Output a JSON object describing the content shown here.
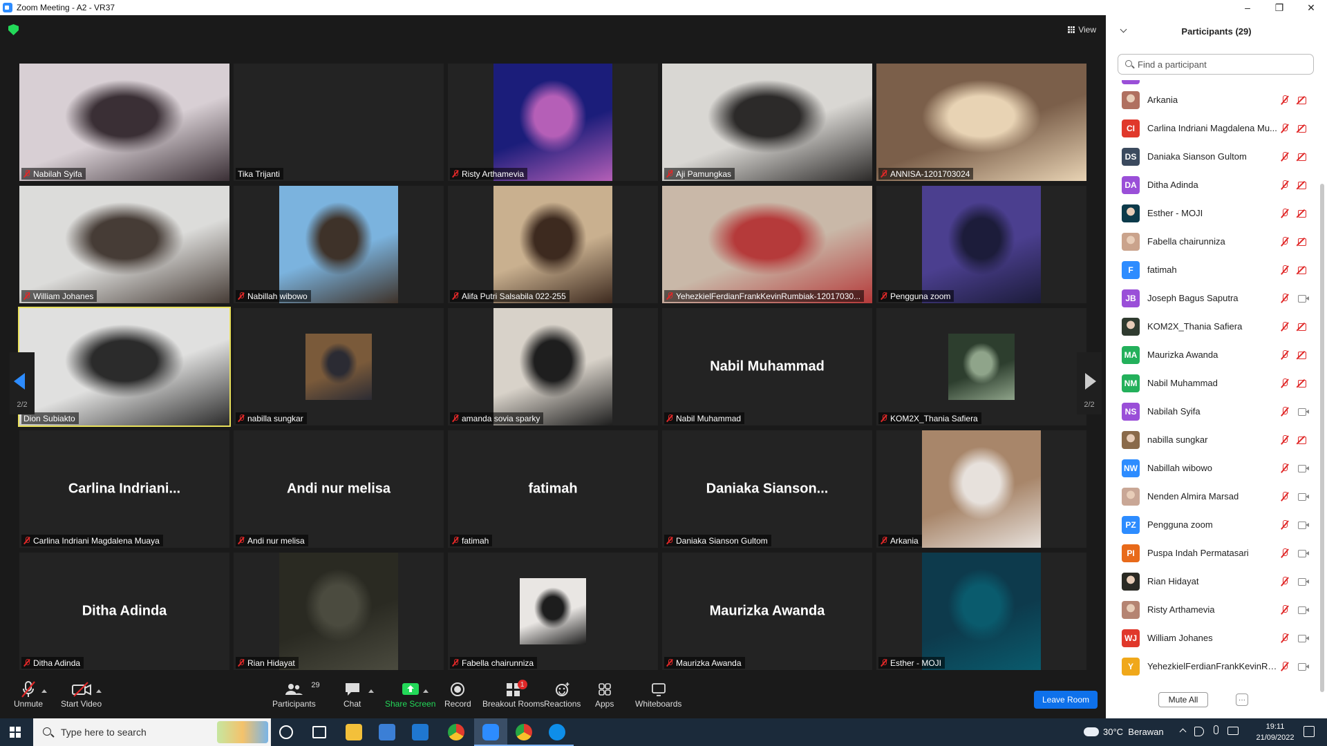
{
  "window": {
    "title": "Zoom Meeting - A2 - VR37",
    "min": "–",
    "max": "❐",
    "close": "✕"
  },
  "stage": {
    "view_label": "View",
    "page_left": "2/2",
    "page_right": "2/2"
  },
  "tiles": [
    {
      "name": "Nabilah Syifa",
      "muted": true,
      "kind": "video",
      "colors": [
        "#d8cfd4",
        "#3a2f35"
      ]
    },
    {
      "name": "Tika Trijanti",
      "muted": false,
      "kind": "dark"
    },
    {
      "name": "Risty Arthamevia",
      "muted": true,
      "kind": "video-narrow",
      "colors": [
        "#1b1d7a",
        "#b55fb7"
      ]
    },
    {
      "name": "Aji Pamungkas",
      "muted": true,
      "kind": "video",
      "colors": [
        "#d9d7d3",
        "#2c2a29"
      ]
    },
    {
      "name": "ANNISA-1201703024",
      "muted": true,
      "kind": "video",
      "colors": [
        "#7b5f4a",
        "#e8d3b4"
      ]
    },
    {
      "name": "William Johanes",
      "muted": true,
      "kind": "video",
      "colors": [
        "#dcdcda",
        "#463c36"
      ]
    },
    {
      "name": "Nabillah wibowo",
      "muted": true,
      "kind": "video-narrow",
      "colors": [
        "#7bb3de",
        "#3e3229"
      ]
    },
    {
      "name": "Alifa Putri Salsabila 022-255",
      "muted": true,
      "kind": "video-narrow",
      "colors": [
        "#c9b08f",
        "#3d2a1f"
      ]
    },
    {
      "name": "YehezkielFerdianFrankKevinRumbiak-12017030...",
      "muted": true,
      "kind": "video",
      "colors": [
        "#c9b8a8",
        "#b53a3a"
      ]
    },
    {
      "name": "Pengguna zoom",
      "muted": true,
      "kind": "video-narrow",
      "colors": [
        "#4b3f8f",
        "#1c1c3a"
      ]
    },
    {
      "name": "Dion Subiakto",
      "muted": false,
      "kind": "video",
      "active": true,
      "colors": [
        "#e0e0df",
        "#2b2b2b"
      ]
    },
    {
      "name": "nabilla sungkar",
      "muted": true,
      "kind": "video-small",
      "colors": [
        "#7a5a3a",
        "#2b2b33"
      ]
    },
    {
      "name": "amanda sovia sparky",
      "muted": true,
      "kind": "video-narrow",
      "colors": [
        "#d8d2c9",
        "#1e1e1e"
      ]
    },
    {
      "name": "Nabil Muhammad",
      "muted": true,
      "kind": "name",
      "big": "Nabil Muhammad"
    },
    {
      "name": "KOM2X_Thania Safiera",
      "muted": true,
      "kind": "video-small",
      "colors": [
        "#2d3e2e",
        "#8fa48a"
      ]
    },
    {
      "name": "Carlina Indriani Magdalena Muaya",
      "muted": true,
      "kind": "name",
      "big": "Carlina  Indriani..."
    },
    {
      "name": "Andi nur melisa",
      "muted": true,
      "kind": "name",
      "big": "Andi nur melisa"
    },
    {
      "name": "fatimah",
      "muted": true,
      "kind": "name",
      "big": "fatimah"
    },
    {
      "name": "Daniaka Sianson Gultom",
      "muted": true,
      "kind": "name",
      "big": "Daniaka  Sianson..."
    },
    {
      "name": "Arkania",
      "muted": true,
      "kind": "video-narrow",
      "colors": [
        "#a8866a",
        "#e7e1dc"
      ]
    },
    {
      "name": "Ditha Adinda",
      "muted": true,
      "kind": "name",
      "big": "Ditha Adinda"
    },
    {
      "name": "Rian Hidayat",
      "muted": true,
      "kind": "video-narrow",
      "colors": [
        "#2a2a22",
        "#4b4b3f"
      ]
    },
    {
      "name": "Fabella chairunniza",
      "muted": true,
      "kind": "video-small",
      "colors": [
        "#e9e6e3",
        "#1d1d1d"
      ]
    },
    {
      "name": "Maurizka Awanda",
      "muted": true,
      "kind": "name",
      "big": "Maurizka Awanda"
    },
    {
      "name": "Esther - MOJI",
      "muted": true,
      "kind": "video-narrow",
      "colors": [
        "#0d3a4c",
        "#0a5b6d"
      ]
    }
  ],
  "toolbar": {
    "unmute": "Unmute",
    "start_video": "Start Video",
    "participants": "Participants",
    "participants_count": "29",
    "chat": "Chat",
    "share_screen": "Share Screen",
    "record": "Record",
    "breakout_rooms": "Breakout Rooms",
    "breakout_badge": "1",
    "reactions": "Reactions",
    "apps": "Apps",
    "whiteboards": "Whiteboards",
    "leave": "Leave Room",
    "colors": {
      "share": "#23d959",
      "leave": "#0e71eb",
      "badge": "#e02828"
    }
  },
  "panel": {
    "title": "Participants (29)",
    "search_placeholder": "Find a participant",
    "mute_all": "Mute All",
    "more": "···",
    "participants": [
      {
        "name": "Arkania",
        "initials": "",
        "color": "#b07060",
        "photo": true,
        "cam_on": false
      },
      {
        "name": "Carlina Indriani Magdalena Mu...",
        "initials": "CI",
        "color": "#e0382b",
        "cam_on": false
      },
      {
        "name": "Daniaka Sianson Gultom",
        "initials": "DS",
        "color": "#3b4a5e",
        "cam_on": false
      },
      {
        "name": "Ditha Adinda",
        "initials": "DA",
        "color": "#9a4fd8",
        "cam_on": false
      },
      {
        "name": "Esther - MOJI",
        "initials": "",
        "color": "#0c3a4a",
        "photo": true,
        "cam_on": false
      },
      {
        "name": "Fabella chairunniza",
        "initials": "",
        "color": "#caa38c",
        "photo": true,
        "cam_on": false
      },
      {
        "name": "fatimah",
        "initials": "F",
        "color": "#2d8cff",
        "cam_on": false
      },
      {
        "name": "Joseph Bagus Saputra",
        "initials": "JB",
        "color": "#9a4fd8",
        "cam_on": true
      },
      {
        "name": "KOM2X_Thania Safiera",
        "initials": "",
        "color": "#2f3b2f",
        "photo": true,
        "cam_on": false
      },
      {
        "name": "Maurizka Awanda",
        "initials": "MA",
        "color": "#23b05b",
        "cam_on": false
      },
      {
        "name": "Nabil Muhammad",
        "initials": "NM",
        "color": "#23b05b",
        "cam_on": false
      },
      {
        "name": "Nabilah Syifa",
        "initials": "NS",
        "color": "#9a4fd8",
        "cam_on": true
      },
      {
        "name": "nabilla sungkar",
        "initials": "",
        "color": "#8a6a4a",
        "photo": true,
        "cam_on": false
      },
      {
        "name": "Nabillah wibowo",
        "initials": "NW",
        "color": "#2d8cff",
        "cam_on": true
      },
      {
        "name": "Nenden Almira Marsad",
        "initials": "",
        "color": "#c9a796",
        "photo": true,
        "cam_on": true
      },
      {
        "name": "Pengguna zoom",
        "initials": "PZ",
        "color": "#2d8cff",
        "cam_on": true
      },
      {
        "name": "Puspa Indah Permatasari",
        "initials": "PI",
        "color": "#e86a1a",
        "cam_on": true
      },
      {
        "name": "Rian Hidayat",
        "initials": "",
        "color": "#2a2a24",
        "photo": true,
        "cam_on": true
      },
      {
        "name": "Risty Arthamevia",
        "initials": "",
        "color": "#b58472",
        "photo": true,
        "cam_on": true
      },
      {
        "name": "William Johanes",
        "initials": "WJ",
        "color": "#e0382b",
        "cam_on": true
      },
      {
        "name": "YehezkielFerdianFrankKevinRu...",
        "initials": "Y",
        "color": "#f0a81a",
        "cam_on": true
      }
    ]
  },
  "taskbar": {
    "search_placeholder": "Type here to search",
    "weather": "30°C  Berawan",
    "time": "19:11",
    "date": "21/09/2022"
  }
}
